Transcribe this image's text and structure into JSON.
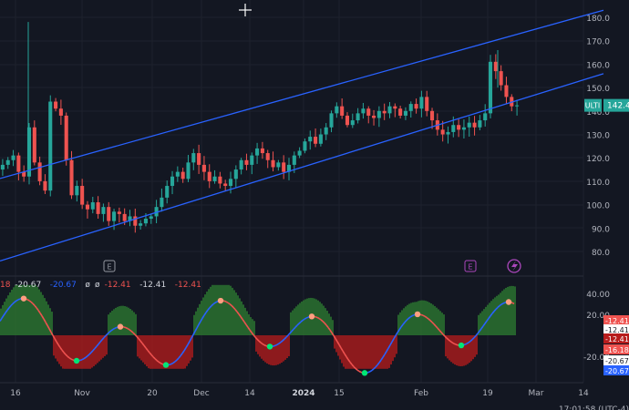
{
  "colors": {
    "background": "#131722",
    "grid": "#1e222d",
    "up": "#26a69a",
    "down": "#ef5350",
    "channel": "#2962ff",
    "axis_text": "#b2b5be",
    "osc_up": "#2e7d32",
    "osc_down": "#b71c1c",
    "osc_line_blue": "#2962ff",
    "osc_line_red": "#ef5350",
    "dot_green": "#00e676",
    "dot_orange": "#ff9e80"
  },
  "header_icons": [
    "crosshair-icon"
  ],
  "price_axis": {
    "ticks": [
      "180.0",
      "170.0",
      "160.0",
      "150.0",
      "140.0",
      "130.0",
      "120.0",
      "110.0",
      "100.0",
      "90.0",
      "80.0"
    ],
    "last_price_label": "142.4",
    "symbol_label": "ULTI"
  },
  "osc_axis": {
    "ticks": [
      "40.00",
      "20.00",
      "-20.00"
    ],
    "badges": [
      {
        "text": "-12.41",
        "color": "#ef5350"
      },
      {
        "text": "-12.41",
        "color": "#ffffff"
      },
      {
        "text": "-12.41",
        "color": "#b71c1c"
      },
      {
        "text": "-16.18",
        "color": "#ef5350"
      },
      {
        "text": "-20.67",
        "color": "#ffffff"
      },
      {
        "text": "-20.67",
        "color": "#2962ff"
      }
    ]
  },
  "osc_legend": [
    "18",
    "-20.67",
    "-20.67",
    "ø",
    "ø",
    "-12.41",
    "-12.41",
    "-12.41"
  ],
  "event_markers": [
    {
      "label": "E",
      "kind": "earnings"
    },
    {
      "label": "E",
      "kind": "earnings-upcoming"
    },
    {
      "label": "",
      "kind": "split"
    }
  ],
  "time_axis": [
    "16",
    "Nov",
    "20",
    "Dec",
    "14",
    "2024",
    "15",
    "Feb",
    "19",
    "Mar",
    "14"
  ],
  "time_axis_right": "17:01:58 (UTC-4)",
  "chart_data": {
    "type": "candlestick",
    "symbol": "ULTI",
    "ylim": [
      75,
      185
    ],
    "close_series": [
      117,
      119,
      121,
      114,
      112,
      133,
      118,
      110,
      106,
      144,
      141,
      138,
      119,
      104,
      108,
      100,
      98,
      101,
      96,
      99,
      93,
      97,
      96,
      93,
      95,
      91,
      92,
      94,
      95,
      99,
      103,
      108,
      112,
      114,
      111,
      118,
      122,
      117,
      114,
      110,
      112,
      109,
      108,
      111,
      115,
      119,
      117,
      121,
      124,
      122,
      119,
      116,
      118,
      114,
      117,
      121,
      123,
      127,
      129,
      126,
      130,
      133,
      139,
      142,
      138,
      134,
      136,
      139,
      141,
      138,
      137,
      140,
      139,
      142,
      141,
      138,
      140,
      143,
      141,
      146,
      140,
      136,
      132,
      130,
      131,
      134,
      132,
      133,
      135,
      133,
      136,
      139,
      161,
      157,
      151,
      146,
      142,
      142.4
    ],
    "channel": {
      "upper": {
        "start_date": "2023-10-16",
        "start_price": 113,
        "end_date": "2024-02-26",
        "end_price": 175
      },
      "lower": {
        "start_date": "2023-10-16",
        "start_price": 78,
        "end_date": "2024-02-26",
        "end_price": 147
      }
    },
    "oscillator": {
      "ylim": [
        -35,
        55
      ],
      "levels": [
        40,
        20,
        -20
      ]
    }
  }
}
